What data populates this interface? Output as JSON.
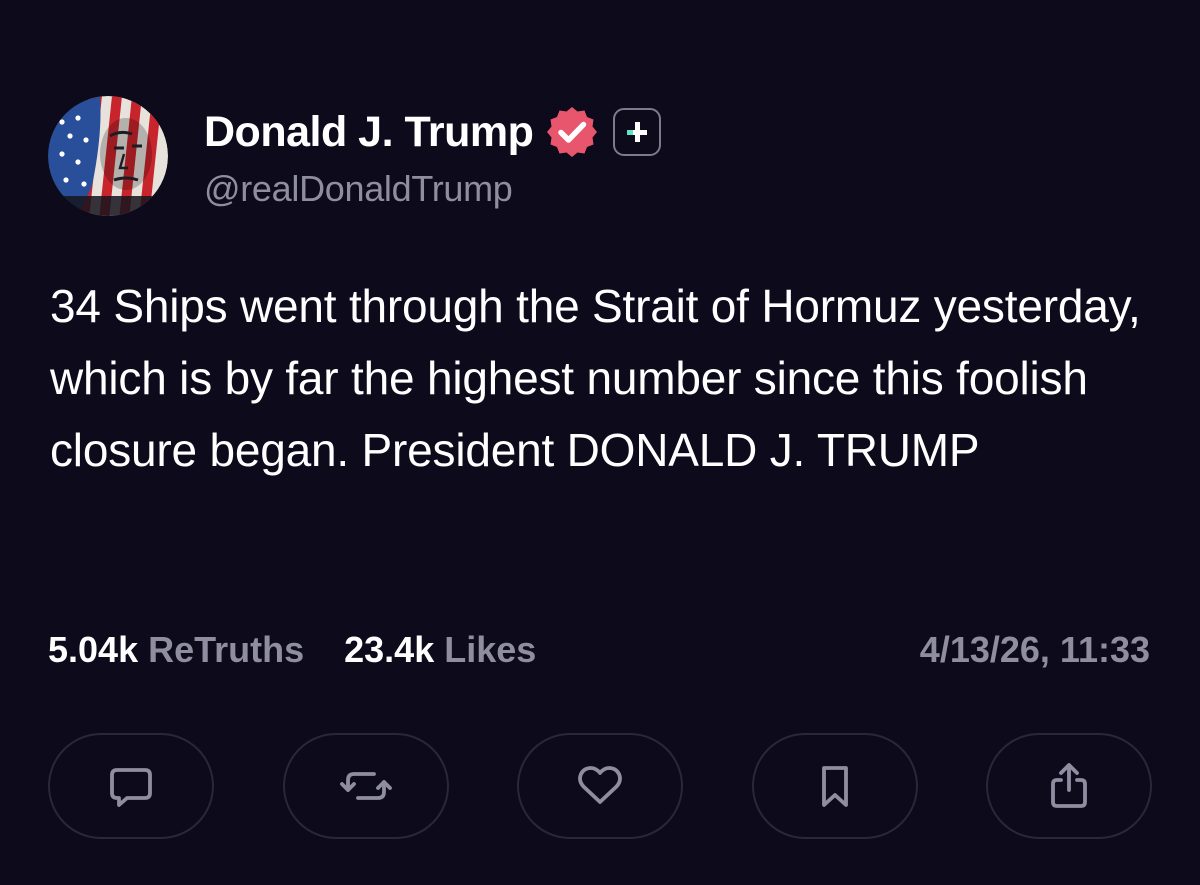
{
  "post": {
    "author": {
      "display_name": "Donald J. Trump",
      "handle": "@realDonaldTrump",
      "avatar_icon": "flag-portrait-avatar",
      "verified_icon": "verified-badge-icon",
      "plus_icon": "plus-badge-icon"
    },
    "text": "34 Ships went through the Strait of Hormuz yesterday, which is by far the highest number since this foolish closure began. President DONALD J. TRUMP",
    "stats": {
      "retruths_count": "5.04k",
      "retruths_label": "ReTruths",
      "likes_count": "23.4k",
      "likes_label": "Likes"
    },
    "timestamp": "4/13/26, 11:33"
  },
  "actions": [
    {
      "name": "reply",
      "icon": "comment-icon"
    },
    {
      "name": "retruth",
      "icon": "retruth-icon"
    },
    {
      "name": "like",
      "icon": "heart-icon"
    },
    {
      "name": "bookmark",
      "icon": "bookmark-icon"
    },
    {
      "name": "share",
      "icon": "share-icon"
    }
  ],
  "colors": {
    "background": "#0c0a1b",
    "primary_text": "#ffffff",
    "secondary_text": "#8f8da0",
    "verified_badge": "#e8566e",
    "plus_accent": "#5fe3c7",
    "button_border": "#2a2838"
  }
}
